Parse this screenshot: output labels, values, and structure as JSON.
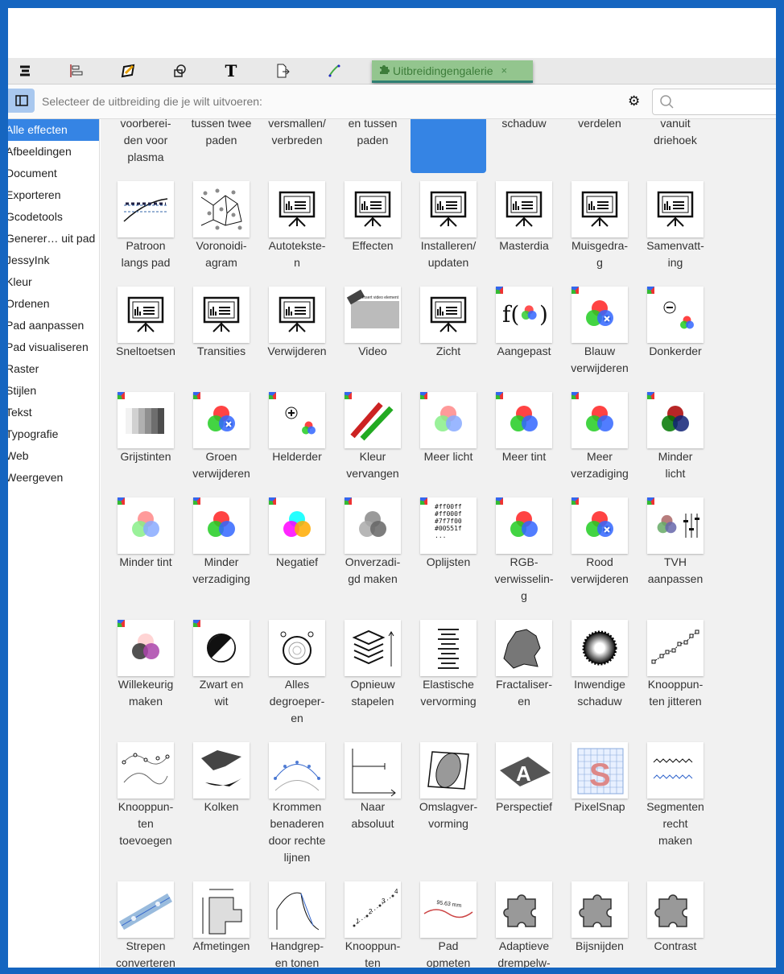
{
  "toolbar": {
    "icons": [
      "align-icon",
      "distribute-icon",
      "pen-icon",
      "objects-icon",
      "text-icon",
      "export-icon",
      "nodes-icon"
    ]
  },
  "tab": {
    "label": "Uitbreidingengalerie",
    "close": "×"
  },
  "header": {
    "prompt": "Selecteer de uitbreiding die je wilt uitvoeren:",
    "gear": "⚙"
  },
  "sidebar": {
    "items": [
      "Alle effecten",
      "Afbeeldingen",
      "Document",
      "Exporteren",
      "Gcodetools",
      "Generer… uit pad",
      "JessyInk",
      "Kleur",
      "Ordenen",
      "Pad aanpassen",
      "Pad visualiseren",
      "Raster",
      "Stijlen",
      "Tekst",
      "Typografie",
      "Web",
      "Weergeven"
    ],
    "selected": 0
  },
  "effects": [
    {
      "label": "voorberei-\nden voor\nplasma",
      "icon": "none"
    },
    {
      "label": "tussen twee\npaden",
      "icon": "none"
    },
    {
      "label": "versmallen/\nverbreden",
      "icon": "none"
    },
    {
      "label": "en tussen\npaden",
      "icon": "none"
    },
    {
      "label": "",
      "icon": "none",
      "selected": true
    },
    {
      "label": "schaduw",
      "icon": "none"
    },
    {
      "label": "verdelen",
      "icon": "none"
    },
    {
      "label": "vanuit\ndriehoek",
      "icon": "none"
    },
    {
      "label": "Patroon\nlangs pad",
      "icon": "pattern"
    },
    {
      "label": "Voronoidi-\nagram",
      "icon": "voronoi"
    },
    {
      "label": "Autotekste-\nn",
      "icon": "board"
    },
    {
      "label": "Effecten",
      "icon": "board"
    },
    {
      "label": "Installeren/\nupdaten",
      "icon": "board"
    },
    {
      "label": "Masterdia",
      "icon": "board"
    },
    {
      "label": "Muisgedra-\ng",
      "icon": "board"
    },
    {
      "label": "Samenvatt-\ning",
      "icon": "board"
    },
    {
      "label": "Sneltoetsen",
      "icon": "board"
    },
    {
      "label": "Transities",
      "icon": "board"
    },
    {
      "label": "Verwijderen",
      "icon": "board"
    },
    {
      "label": "Video",
      "icon": "video"
    },
    {
      "label": "Zicht",
      "icon": "board"
    },
    {
      "label": "Aangepast",
      "icon": "fx",
      "badge": true
    },
    {
      "label": "Blauw\nverwijderen",
      "icon": "rgb-x",
      "badge": true
    },
    {
      "label": "Donkerder",
      "icon": "sun-minus",
      "badge": true
    },
    {
      "label": "Grijstinten",
      "icon": "grayscale",
      "badge": true
    },
    {
      "label": "Groen\nverwijderen",
      "icon": "rgb-x",
      "badge": true
    },
    {
      "label": "Helderder",
      "icon": "sun-plus",
      "badge": true
    },
    {
      "label": "Kleur\nvervangen",
      "icon": "pencils",
      "badge": true
    },
    {
      "label": "Meer licht",
      "icon": "rgb-light",
      "badge": true
    },
    {
      "label": "Meer tint",
      "icon": "rgb",
      "badge": true
    },
    {
      "label": "Meer\nverzadiging",
      "icon": "rgb",
      "badge": true
    },
    {
      "label": "Minder\nlicht",
      "icon": "rgb-dark",
      "badge": true
    },
    {
      "label": "Minder tint",
      "icon": "rgb-light",
      "badge": true
    },
    {
      "label": "Minder\nverzadiging",
      "icon": "rgb",
      "badge": true
    },
    {
      "label": "Negatief",
      "icon": "rgb-neg",
      "badge": true
    },
    {
      "label": "Onverzadi-\ngd maken",
      "icon": "rgb-gray",
      "badge": true
    },
    {
      "label": "Oplijsten",
      "icon": "hexlist",
      "badge": true
    },
    {
      "label": "RGB-\nverwisselin-\ng",
      "icon": "rgb",
      "badge": true
    },
    {
      "label": "Rood\nverwijderen",
      "icon": "rgb-x",
      "badge": true
    },
    {
      "label": "TVH\naanpassen",
      "icon": "tvh",
      "badge": true
    },
    {
      "label": "Willekeurig\nmaken",
      "icon": "rgb-random",
      "badge": true
    },
    {
      "label": "Zwart en\nwit",
      "icon": "bw",
      "badge": true
    },
    {
      "label": "Alles\ndegroeper-\nen",
      "icon": "ungroup"
    },
    {
      "label": "Opnieuw\nstapelen",
      "icon": "stack"
    },
    {
      "label": "Elastische\nvervorming",
      "icon": "elastic"
    },
    {
      "label": "Fractaliser-\nen",
      "icon": "fractal"
    },
    {
      "label": "Inwendige\nschaduw",
      "icon": "innershadow"
    },
    {
      "label": "Knooppun-\nten jitteren",
      "icon": "jitter"
    },
    {
      "label": "Knooppun-\nten\ntoevoegen",
      "icon": "addnodes"
    },
    {
      "label": "Kolken",
      "icon": "whirl"
    },
    {
      "label": "Krommen\nbenaderen\ndoor rechte\nlijnen",
      "icon": "curves"
    },
    {
      "label": "Naar\nabsoluut",
      "icon": "absolute"
    },
    {
      "label": "Omslagver-\nvorming",
      "icon": "envelope"
    },
    {
      "label": "Perspectief",
      "icon": "perspective"
    },
    {
      "label": "PixelSnap",
      "icon": "pixelsnap"
    },
    {
      "label": "Segmenten\nrecht\nmaken",
      "icon": "straighten"
    },
    {
      "label": "Strepen\nconverteren",
      "icon": "strokes"
    },
    {
      "label": "Afmetingen",
      "icon": "dimensions"
    },
    {
      "label": "Handgrep-\nen tonen",
      "icon": "handles"
    },
    {
      "label": "Knooppun-\nten",
      "icon": "numbers"
    },
    {
      "label": "Pad\nopmeten",
      "icon": "measure"
    },
    {
      "label": "Adaptieve\ndrempelw-",
      "icon": "puzzle"
    },
    {
      "label": "Bijsnijden",
      "icon": "puzzle"
    },
    {
      "label": "Contrast",
      "icon": "puzzle"
    }
  ],
  "icon_texts": {
    "video": "Insert video element",
    "hexlist": "#ff00ff\n#ff000f\n#7f7f00\n#00551f\n...",
    "measure": "95.63 mm"
  },
  "colors": {
    "accent": "#3584e4",
    "frame": "#1565c0",
    "tab": "#93c58e"
  }
}
